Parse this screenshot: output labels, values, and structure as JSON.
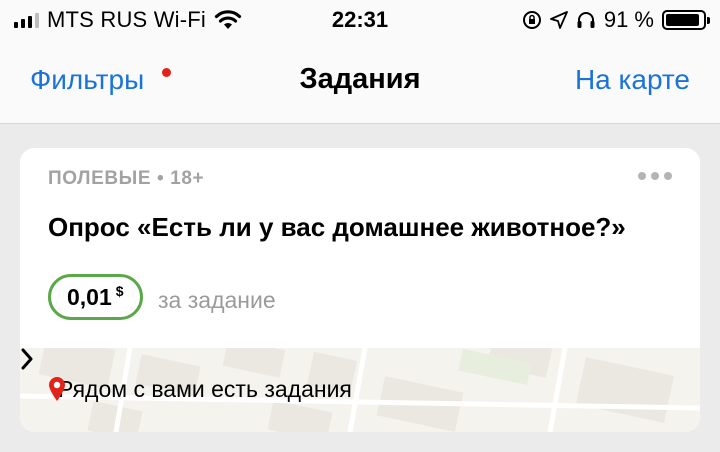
{
  "status_bar": {
    "carrier": "MTS RUS Wi-Fi",
    "time": "22:31",
    "battery": "91 %"
  },
  "nav": {
    "left": "Фильтры",
    "title": "Задания",
    "right": "На карте"
  },
  "task": {
    "category": "ПОЛЕВЫЕ • 18+",
    "title": "Опрос «Есть ли у вас домашнее животное?»",
    "price": "0,01",
    "currency": "$",
    "price_caption": "за задание"
  },
  "map": {
    "label": "Рядом с вами есть задания"
  },
  "colors": {
    "accent": "#1a73d9",
    "notification": "#e2231a",
    "price_border": "#5ba84a",
    "location_pin": "#e2231a"
  },
  "icons": [
    "signal-icon",
    "wifi-icon",
    "lock-rotation-icon",
    "location-arrow-icon",
    "headphones-icon",
    "battery-icon",
    "more-icon",
    "location-pin-icon",
    "chevron-right-icon"
  ]
}
